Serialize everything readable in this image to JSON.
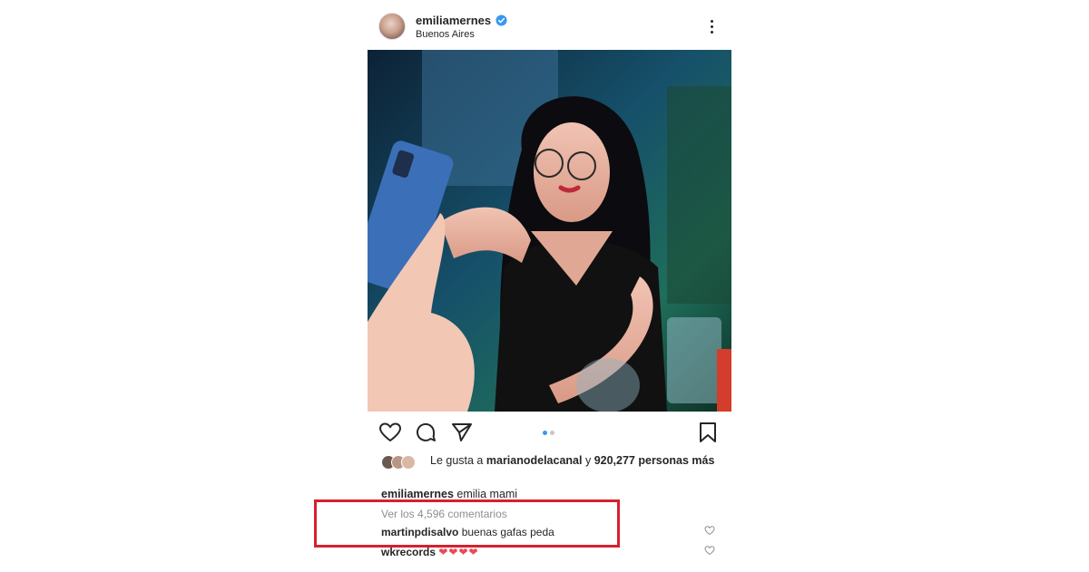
{
  "header": {
    "username": "emiliamernes",
    "location": "Buenos Aires",
    "verified_icon": "verified-badge-icon",
    "more_icon": "more-options-icon"
  },
  "photo": {
    "icon": "post-photo",
    "carousel_count": 2,
    "carousel_active": 1
  },
  "actions": {
    "like_icon": "heart-icon",
    "comment_icon": "comment-icon",
    "share_icon": "send-icon",
    "save_icon": "bookmark-icon"
  },
  "likes": {
    "prefix": "Le gusta a",
    "user": "marianodelacanal",
    "connector": "y",
    "count": "920,277 personas más"
  },
  "caption": {
    "user": "emiliamernes",
    "text": "emilia mami"
  },
  "comments": {
    "view_all": "Ver los 4,596 comentarios",
    "items": [
      {
        "user": "martinpdisalvo",
        "text": "buenas gafas peda"
      },
      {
        "user": "wkrecords",
        "text": "❤❤❤❤"
      }
    ]
  },
  "colors": {
    "highlight": "#d6202e",
    "carousel_active": "#3897f0",
    "verified": "#3897f0",
    "hearts": "#ed4956"
  }
}
